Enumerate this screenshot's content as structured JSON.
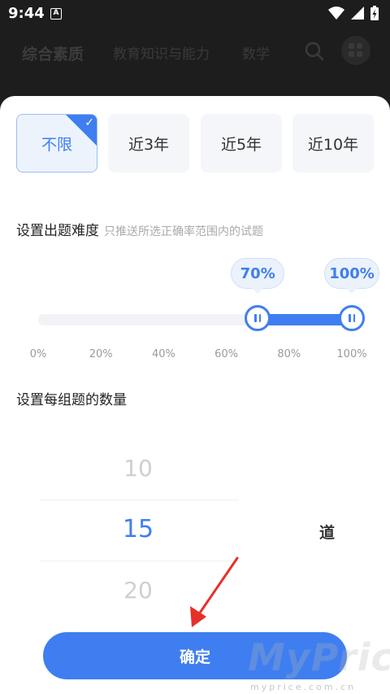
{
  "status_bar": {
    "time": "9:44",
    "notif_label": "A"
  },
  "header": {
    "tabs": [
      {
        "label": "综合素质",
        "active": true
      },
      {
        "label": "教育知识与能力",
        "active": false
      },
      {
        "label": "数学",
        "active": false
      }
    ],
    "icons": [
      "search-icon",
      "grid-apps-icon"
    ]
  },
  "year_filter": {
    "options": [
      {
        "label": "不限",
        "selected": true
      },
      {
        "label": "近3年",
        "selected": false
      },
      {
        "label": "近5年",
        "selected": false
      },
      {
        "label": "近10年",
        "selected": false
      }
    ]
  },
  "difficulty": {
    "title": "设置出题难度",
    "subtitle": "只推送所选正确率范围内的试题",
    "low_label": "70%",
    "high_label": "100%",
    "low_value": 70,
    "high_value": 100,
    "ticks": [
      "0%",
      "20%",
      "40%",
      "60%",
      "80%",
      "100%"
    ]
  },
  "quantity": {
    "title": "设置每组题的数量",
    "options": [
      "10",
      "15",
      "20"
    ],
    "selected": "15",
    "unit": "道"
  },
  "confirm_label": "确定",
  "watermark": {
    "text": "MyPrice",
    "sub": "myprice.com.cn"
  },
  "colors": {
    "accent": "#3f7ef0",
    "arrow": "#e5312a"
  }
}
